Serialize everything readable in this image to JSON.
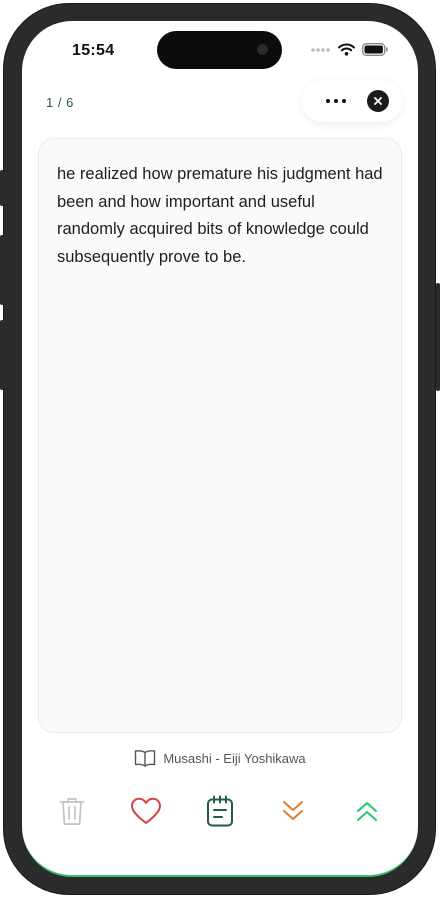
{
  "status_bar": {
    "time": "15:54"
  },
  "header": {
    "page_counter": "1 / 6"
  },
  "card": {
    "quote": "he realized how premature his judgment had been and how important and useful randomly acquired bits of knowledge could subsequently prove to be."
  },
  "source": {
    "text": "Musashi - Eiji Yoshikawa"
  },
  "toolbar": {
    "icons": [
      "trash-icon",
      "heart-icon",
      "notepad-icon",
      "chevrons-down-icon",
      "chevrons-up-icon"
    ]
  },
  "colors": {
    "accent_green": "#245b4e",
    "heart_red": "#d9434b",
    "down_orange": "#e07b2c",
    "up_green": "#2cc46a",
    "trash_gray": "#c4c4c4"
  }
}
